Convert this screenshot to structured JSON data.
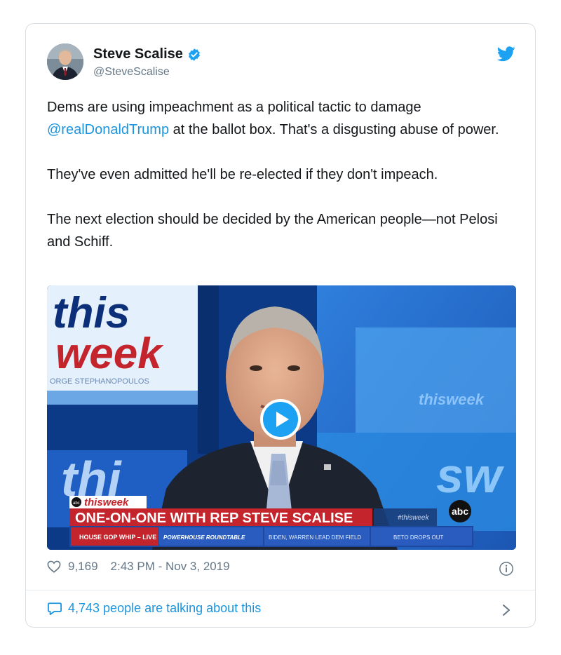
{
  "author": {
    "display_name": "Steve Scalise",
    "handle": "@SteveScalise",
    "verified": true
  },
  "tweet": {
    "p1_before": "Dems are using impeachment as a political tactic to damage ",
    "p1_mention": "@realDonaldTrump",
    "p1_after": " at the ballot box. That's a disgusting abuse of power.",
    "p2": "They've even admitted he'll be re-elected if they don't impeach.",
    "p3": "The next election should be decided by the American people—not Pelosi and Schiff."
  },
  "video": {
    "show_word_1": "this",
    "show_word_2": "week",
    "subtitle": "ORGE STEPHANOPOULOS",
    "bg_word": "thisweek",
    "lower_third_brand": "thisweek",
    "headline": "ONE-ON-ONE WITH REP STEVE SCALISE",
    "ticker": [
      "HOUSE GOP WHIP – LIVE",
      "POWERHOUSE ROUNDTABLE",
      "BIDEN, WARREN LEAD DEM FIELD",
      "BETO DROPS OUT"
    ],
    "hashtag": "#thisweek",
    "network": "abc"
  },
  "meta": {
    "likes": "9,169",
    "timestamp": "2:43 PM - Nov 3, 2019"
  },
  "footer": {
    "talking": "4,743 people are talking about this"
  },
  "colors": {
    "link": "#1b95e0",
    "twitter_blue": "#1da1f2",
    "banner_red": "#c4242b"
  }
}
